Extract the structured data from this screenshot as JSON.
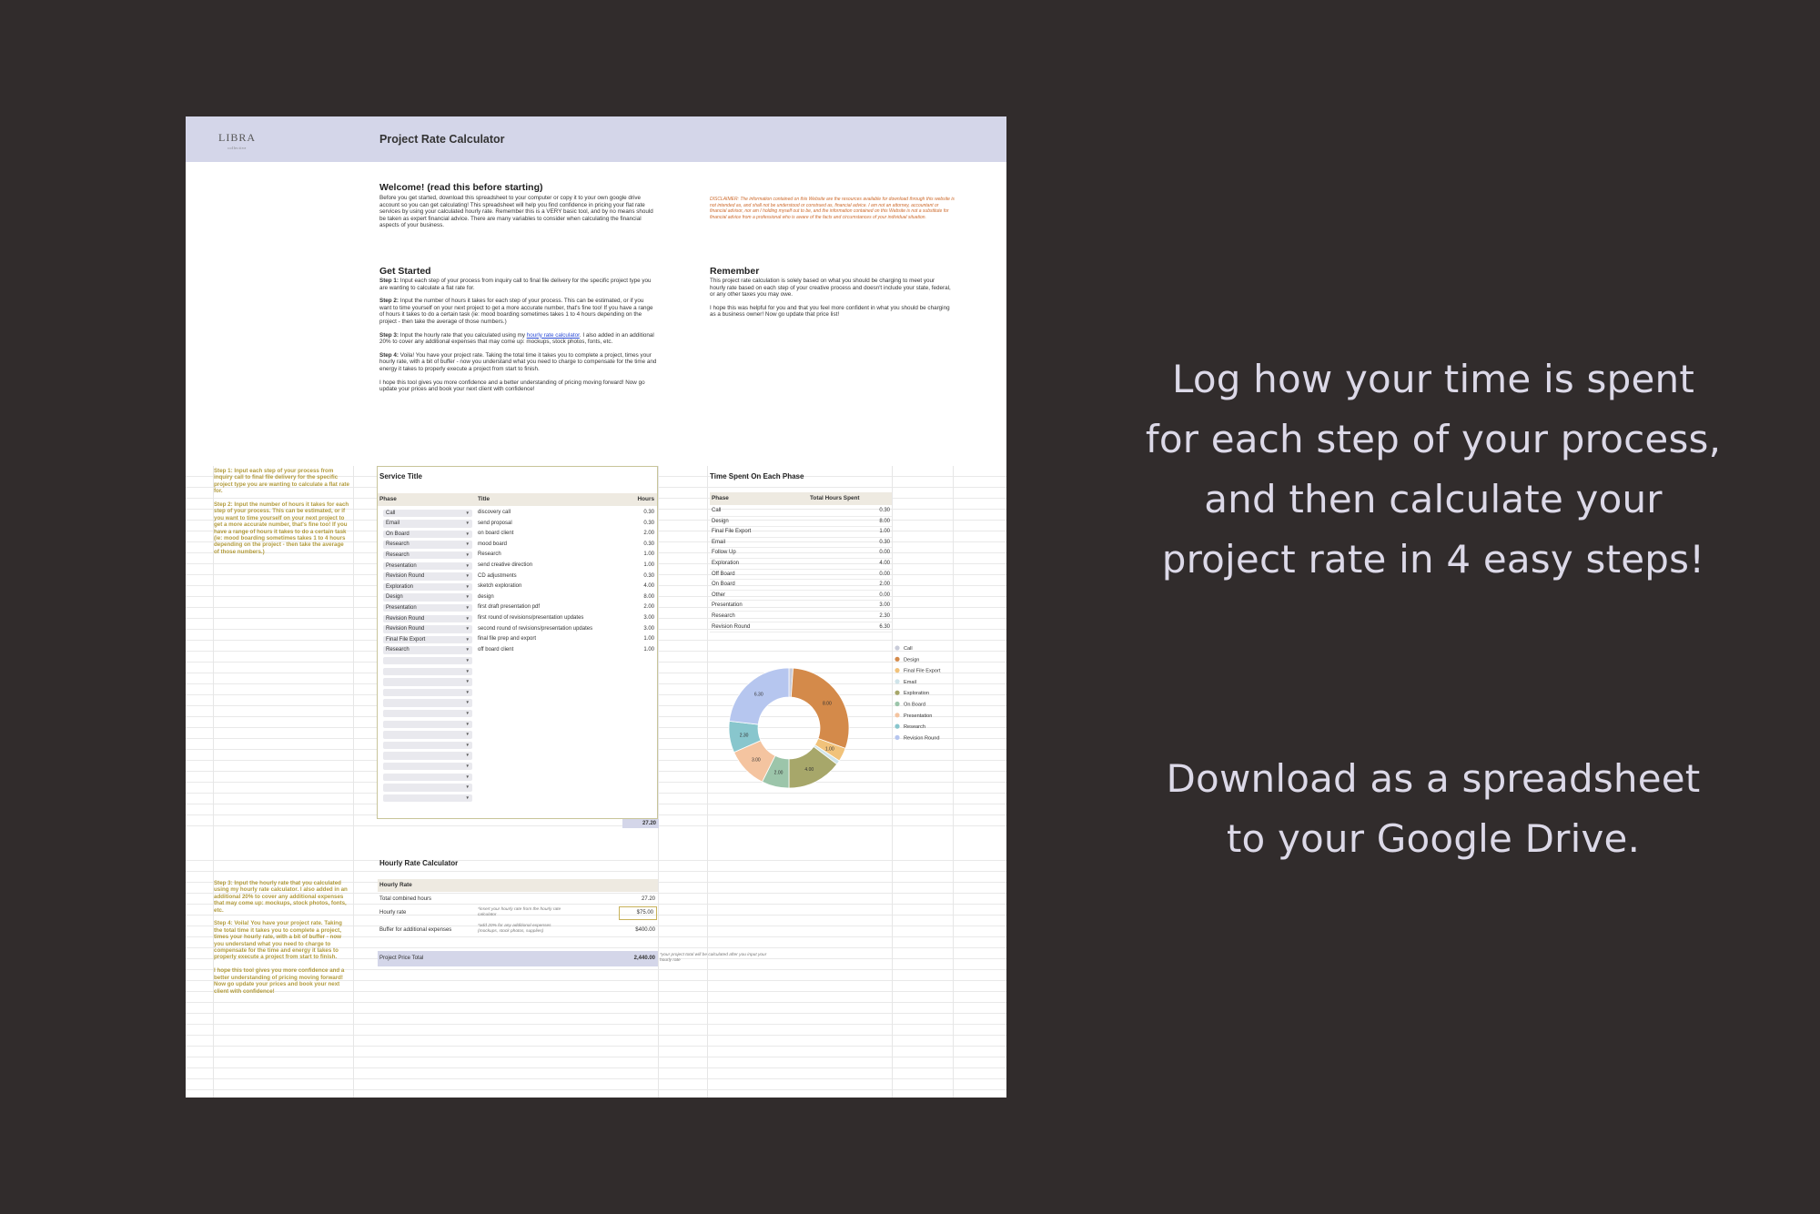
{
  "sheet": {
    "logo": "LIBRA",
    "logo_sub": "collective",
    "title": "Project Rate Calculator",
    "welcome": {
      "heading": "Welcome! (read this before starting)",
      "body": "Before you get started, download this spreadsheet to your computer or copy it to your own google drive account so you can get calculating! This spreadsheet will help you find confidence in pricing your flat rate services by using your calculated hourly rate. Remember this is a VERY basic tool, and by no means should be taken as expert financial advice. There are many variables to consider when calculating the financial aspects of your business."
    },
    "disclaimer": "DISCLAIMER: The information contained on this Website are the resources available for download through this website is not intended as, and shall not be understood or construed as, financial advice. I am not an attorney, accountant or financial advisor, nor am I holding myself out to be, and the information contained on this Website is not a substitute for financial advice from a professional who is aware of the facts and circumstances of your individual situation.",
    "get_started": {
      "heading": "Get Started",
      "step1_label": "Step 1:",
      "step1": "Input each step of your process from inquiry call to final file delivery for the specific project type you are wanting to calculate a flat rate for.",
      "step2_label": "Step 2:",
      "step2": "Input the number of hours it takes for each step of your process. This can be estimated, or if you want to time yourself on your next project to get a more accurate number, that's fine too! If you have a range of hours it takes to do a certain task (ie: mood boarding sometimes takes 1 to 4 hours depending on the project - then take the average of those numbers.)",
      "step3_label": "Step 3:",
      "step3_pre": "Input the hourly rate that you calculated using my",
      "step3_link": "hourly rate calculator",
      "step3_post": ". I also added in an additional 20% to cover any additional expenses that may come up: mockups, stock photos, fonts, etc.",
      "step4_label": "Step 4:",
      "step4": "Voila! You have your project rate. Taking the total time it takes you to complete a project, times your hourly rate, with a bit of buffer - now you understand what you need to charge to compensate for the time and energy it takes to properly execute a project from start to finish.",
      "closing": "I hope this tool gives you more confidence and a better understanding of pricing moving forward! Now go update your prices and book your next client with confidence!"
    },
    "remember": {
      "heading": "Remember",
      "body1": "This project rate calculation is solely based on what you should be charging to meet your hourly rate based on each step of your creative process and doesn't include your state, federal, or any other taxes you may owe.",
      "body2": "I hope this was helpful for you and that you feel more confident in what you should be charging as a business owner! Now go update that price list!"
    },
    "side_notes_1": "Step 1: Input each step of your process from inquiry call to final file delivery for the specific project type you are wanting to calculate a flat rate for.\n\nStep 2: Input the number of hours it takes for each step of your process. This can be estimated, or if you want to time yourself on your next project to get a more accurate number, that's fine too! If you have a range of hours it takes to do a certain task (ie: mood boarding sometimes takes 1 to 4 hours depending on the project - then take the average of those numbers.)",
    "side_notes_2": "Step 3: Input the hourly rate that you calculated using my hourly rate calculator. I also added in an additional 20% to cover any additional expenses that may come up: mockups, stock photos, fonts, etc.\n\nStep 4: Voila! You have your project rate. Taking the total time it takes you to complete a project, times your hourly rate, with a bit of buffer - now you understand what you need to charge to compensate for the time and energy it takes to properly execute a project from start to finish.\n\nI hope this tool gives you more confidence and a better understanding of pricing moving forward! Now go update your prices and book your next client with confidence!",
    "service": {
      "heading": "Service Title",
      "col_phase": "Phase",
      "col_title": "Title",
      "col_hours": "Hours",
      "rows": [
        {
          "phase": "Call",
          "title": "discovery call",
          "hours": "0.30"
        },
        {
          "phase": "Email",
          "title": "send proposal",
          "hours": "0.30"
        },
        {
          "phase": "On Board",
          "title": "on board client",
          "hours": "2.00"
        },
        {
          "phase": "Research",
          "title": "mood board",
          "hours": "0.30"
        },
        {
          "phase": "Research",
          "title": "Research",
          "hours": "1.00"
        },
        {
          "phase": "Presentation",
          "title": "send creative direction",
          "hours": "1.00"
        },
        {
          "phase": "Revision Round",
          "title": "CD adjustments",
          "hours": "0.30"
        },
        {
          "phase": "Exploration",
          "title": "sketch exploration",
          "hours": "4.00"
        },
        {
          "phase": "Design",
          "title": "design",
          "hours": "8.00"
        },
        {
          "phase": "Presentation",
          "title": "first draft presentation pdf",
          "hours": "2.00"
        },
        {
          "phase": "Revision Round",
          "title": "first round of revisions/presentation updates",
          "hours": "3.00"
        },
        {
          "phase": "Revision Round",
          "title": "second round of revisions/presentation updates",
          "hours": "3.00"
        },
        {
          "phase": "Final File Export",
          "title": "final file prep and export",
          "hours": "1.00"
        },
        {
          "phase": "Research",
          "title": "off board client",
          "hours": "1.00"
        }
      ],
      "empty_rows": 14,
      "total": "27.20"
    },
    "time_spent": {
      "heading": "Time Spent On Each Phase",
      "col_phase": "Phase",
      "col_total": "Total Hours Spent",
      "rows": [
        {
          "phase": "Call",
          "hours": "0.30"
        },
        {
          "phase": "Design",
          "hours": "8.00"
        },
        {
          "phase": "Final File Export",
          "hours": "1.00"
        },
        {
          "phase": "Email",
          "hours": "0.30"
        },
        {
          "phase": "Follow Up",
          "hours": "0.00"
        },
        {
          "phase": "Exploration",
          "hours": "4.00"
        },
        {
          "phase": "Off Board",
          "hours": "0.00"
        },
        {
          "phase": "On Board",
          "hours": "2.00"
        },
        {
          "phase": "Other",
          "hours": "0.00"
        },
        {
          "phase": "Presentation",
          "hours": "3.00"
        },
        {
          "phase": "Research",
          "hours": "2.30"
        },
        {
          "phase": "Revision Round",
          "hours": "6.30"
        }
      ]
    },
    "hourly": {
      "heading": "Hourly Rate Calculator",
      "section": "Hourly Rate",
      "total_hours_label": "Total combined hours",
      "total_hours": "27.20",
      "rate_label": "Hourly rate",
      "rate_note": "*insert your hourly rate from the hourly rate calculator",
      "rate": "$75.00",
      "buffer_label": "Buffer for additional expenses",
      "buffer_note": "*add 20% for any additional expenses (mockups, stock photos, supplies)",
      "buffer": "$400.00",
      "project_total_label": "Project Price Total",
      "project_total": "2,440.00",
      "project_note": "*your project total will be calculated after you input your hourly rate"
    }
  },
  "chart_data": {
    "type": "pie",
    "donut": true,
    "categories": [
      "Call",
      "Design",
      "Final File Export",
      "Email",
      "Exploration",
      "On Board",
      "Presentation",
      "Research",
      "Revision Round"
    ],
    "values": [
      0.3,
      8.0,
      1.0,
      0.3,
      4.0,
      2.0,
      3.0,
      2.3,
      6.3
    ],
    "slice_labels": [
      "",
      "8.00",
      "1.00",
      "",
      "4.00",
      "2.00",
      "3.00",
      "2.30",
      "6.30"
    ],
    "colors": [
      "#c9ccd9",
      "#d48a4a",
      "#f1c27a",
      "#cfe4ea",
      "#a7a76a",
      "#9cc5aa",
      "#f4c4a0",
      "#88c6cd",
      "#b6c6ef"
    ],
    "legend_position": "right"
  },
  "promo": {
    "line1": "Log how your time is spent",
    "line2": "for each step of your process,",
    "line3": "and then calculate your",
    "line4": "project rate in 4 easy steps!",
    "line5": "Download as a spreadsheet",
    "line6": "to your Google Drive."
  }
}
